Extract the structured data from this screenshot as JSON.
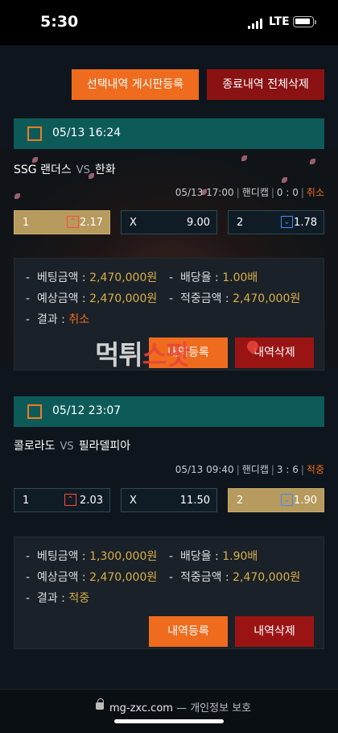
{
  "status": {
    "time": "5:30",
    "network": "LTE"
  },
  "top_buttons": {
    "post": "선택내역 게시판등록",
    "delete_all": "종료내역 전체삭제"
  },
  "watermark": {
    "main": "먹튀",
    "accent": "스팟"
  },
  "bets": [
    {
      "date": "05/13 16:24",
      "home": "SSG 랜더스",
      "vs": "VS",
      "away": "한화",
      "match_time": "05/13 17:00",
      "bet_type": "핸디캡",
      "score": "0 : 0",
      "result_tag": "취소",
      "odds": [
        {
          "pick": "1",
          "value": "2.17",
          "arrow": "up"
        },
        {
          "pick": "X",
          "value": "9.00"
        },
        {
          "pick": "2",
          "value": "1.78",
          "arrow": "down"
        }
      ],
      "selected": "1",
      "details": {
        "bet_amount_label": "베팅금액",
        "bet_amount": "2,470,000원",
        "odds_label": "배당율",
        "odds_value": "1.00배",
        "expected_label": "예상금액",
        "expected": "2,470,000원",
        "won_label": "적중금액",
        "won": "2,470,000원",
        "result_label": "결과",
        "result": "취소"
      },
      "register_btn": "내역등록",
      "delete_btn": "내역삭제"
    },
    {
      "date": "05/12 23:07",
      "home": "콜로라도",
      "vs": "VS",
      "away": "필라델피아",
      "match_time": "05/13 09:40",
      "bet_type": "핸디캡",
      "score": "3 : 6",
      "result_tag": "적중",
      "odds": [
        {
          "pick": "1",
          "value": "2.03",
          "arrow": "up"
        },
        {
          "pick": "X",
          "value": "11.50"
        },
        {
          "pick": "2",
          "value": "1.90",
          "arrow": "down"
        }
      ],
      "selected": "2",
      "details": {
        "bet_amount_label": "베팅금액",
        "bet_amount": "1,300,000원",
        "odds_label": "배당율",
        "odds_value": "1.90배",
        "expected_label": "예상금액",
        "expected": "2,470,000원",
        "won_label": "적중금액",
        "won": "2,470,000원",
        "result_label": "결과",
        "result": "적중"
      },
      "register_btn": "내역등록",
      "delete_btn": "내역삭제"
    }
  ],
  "footer": {
    "url": "mg-zxc.com",
    "privacy": "— 개인정보 보호"
  }
}
